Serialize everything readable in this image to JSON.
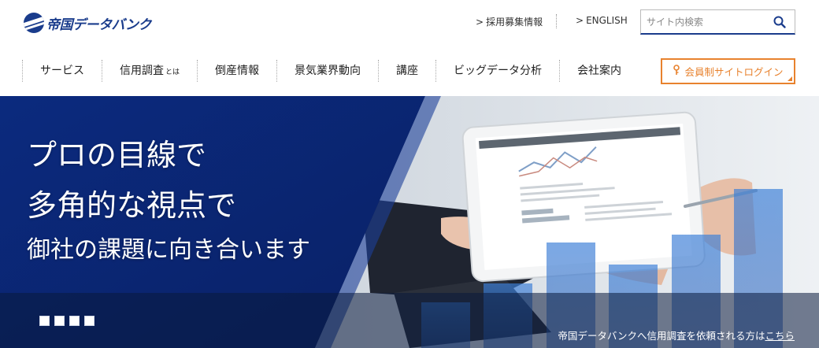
{
  "brand": {
    "name": "帝国データバンク"
  },
  "utility": {
    "recruit_label": "採用募集情報",
    "english_label": "ENGLISH",
    "arrow": ">"
  },
  "search": {
    "placeholder": "サイト内検索",
    "value": ""
  },
  "nav": {
    "items": [
      {
        "label": "サービス"
      },
      {
        "label": "信用調査",
        "sub": "とは"
      },
      {
        "label": "倒産情報"
      },
      {
        "label": "景気業界動向"
      },
      {
        "label": "講座"
      },
      {
        "label": "ビッグデータ分析"
      },
      {
        "label": "会社案内"
      }
    ],
    "login_label": "会員制サイトログイン"
  },
  "hero": {
    "line1": "プロの目線で",
    "line2": "多角的な視点で",
    "line3": "御社の課題に向き合います",
    "note_text": "帝国データバンクへ信用調査を依頼される方は",
    "note_link": "こちら",
    "slide_count": 4
  },
  "colors": {
    "brand_blue": "#1a3c8c",
    "accent_orange": "#e8822e",
    "hero_navy": "#0d2a78"
  }
}
